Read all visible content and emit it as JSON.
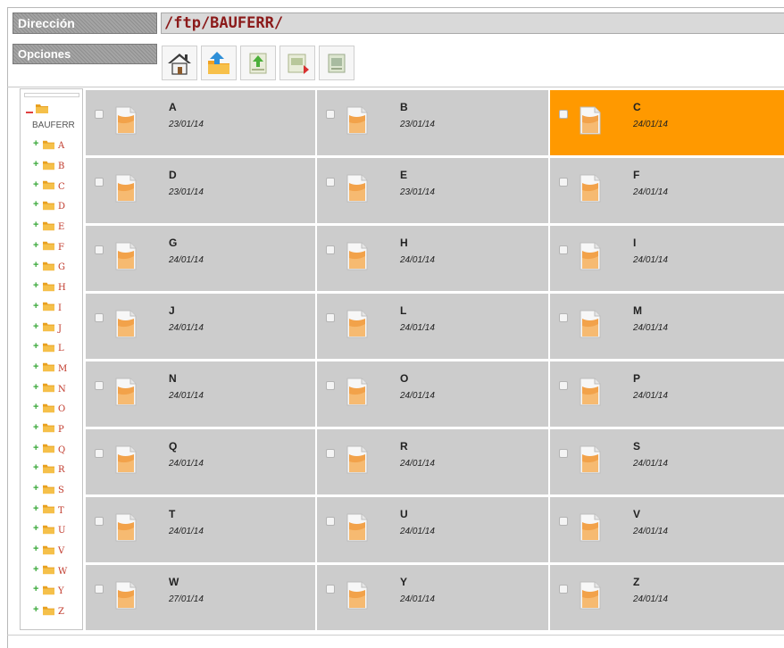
{
  "header": {
    "direction_label": "Dirección",
    "path": "/ftp/BAUFERR/",
    "options_label": "Opciones"
  },
  "toolbar": [
    {
      "icon": "home-icon"
    },
    {
      "icon": "upload-folder-icon"
    },
    {
      "icon": "upload-file-icon"
    },
    {
      "icon": "download-file-icon"
    },
    {
      "icon": "delete-file-icon"
    }
  ],
  "tree": {
    "root": "BAUFERR",
    "items": [
      "A",
      "B",
      "C",
      "D",
      "E",
      "F",
      "G",
      "H",
      "I",
      "J",
      "L",
      "M",
      "N",
      "O",
      "P",
      "Q",
      "R",
      "S",
      "T",
      "U",
      "V",
      "W",
      "Y",
      "Z"
    ]
  },
  "files": [
    {
      "name": "A",
      "date": "23/01/14",
      "selected": false
    },
    {
      "name": "B",
      "date": "23/01/14",
      "selected": false
    },
    {
      "name": "C",
      "date": "24/01/14",
      "selected": true
    },
    {
      "name": "D",
      "date": "23/01/14",
      "selected": false
    },
    {
      "name": "E",
      "date": "23/01/14",
      "selected": false
    },
    {
      "name": "F",
      "date": "24/01/14",
      "selected": false
    },
    {
      "name": "G",
      "date": "24/01/14",
      "selected": false
    },
    {
      "name": "H",
      "date": "24/01/14",
      "selected": false
    },
    {
      "name": "I",
      "date": "24/01/14",
      "selected": false
    },
    {
      "name": "J",
      "date": "24/01/14",
      "selected": false
    },
    {
      "name": "L",
      "date": "24/01/14",
      "selected": false
    },
    {
      "name": "M",
      "date": "24/01/14",
      "selected": false
    },
    {
      "name": "N",
      "date": "24/01/14",
      "selected": false
    },
    {
      "name": "O",
      "date": "24/01/14",
      "selected": false
    },
    {
      "name": "P",
      "date": "24/01/14",
      "selected": false
    },
    {
      "name": "Q",
      "date": "24/01/14",
      "selected": false
    },
    {
      "name": "R",
      "date": "24/01/14",
      "selected": false
    },
    {
      "name": "S",
      "date": "24/01/14",
      "selected": false
    },
    {
      "name": "T",
      "date": "24/01/14",
      "selected": false
    },
    {
      "name": "U",
      "date": "24/01/14",
      "selected": false
    },
    {
      "name": "V",
      "date": "24/01/14",
      "selected": false
    },
    {
      "name": "W",
      "date": "27/01/14",
      "selected": false
    },
    {
      "name": "Y",
      "date": "24/01/14",
      "selected": false
    },
    {
      "name": "Z",
      "date": "24/01/14",
      "selected": false
    }
  ],
  "colors": {
    "selected": "#ff9900",
    "cell": "#cccccc",
    "path_text": "#8b1a1a"
  }
}
